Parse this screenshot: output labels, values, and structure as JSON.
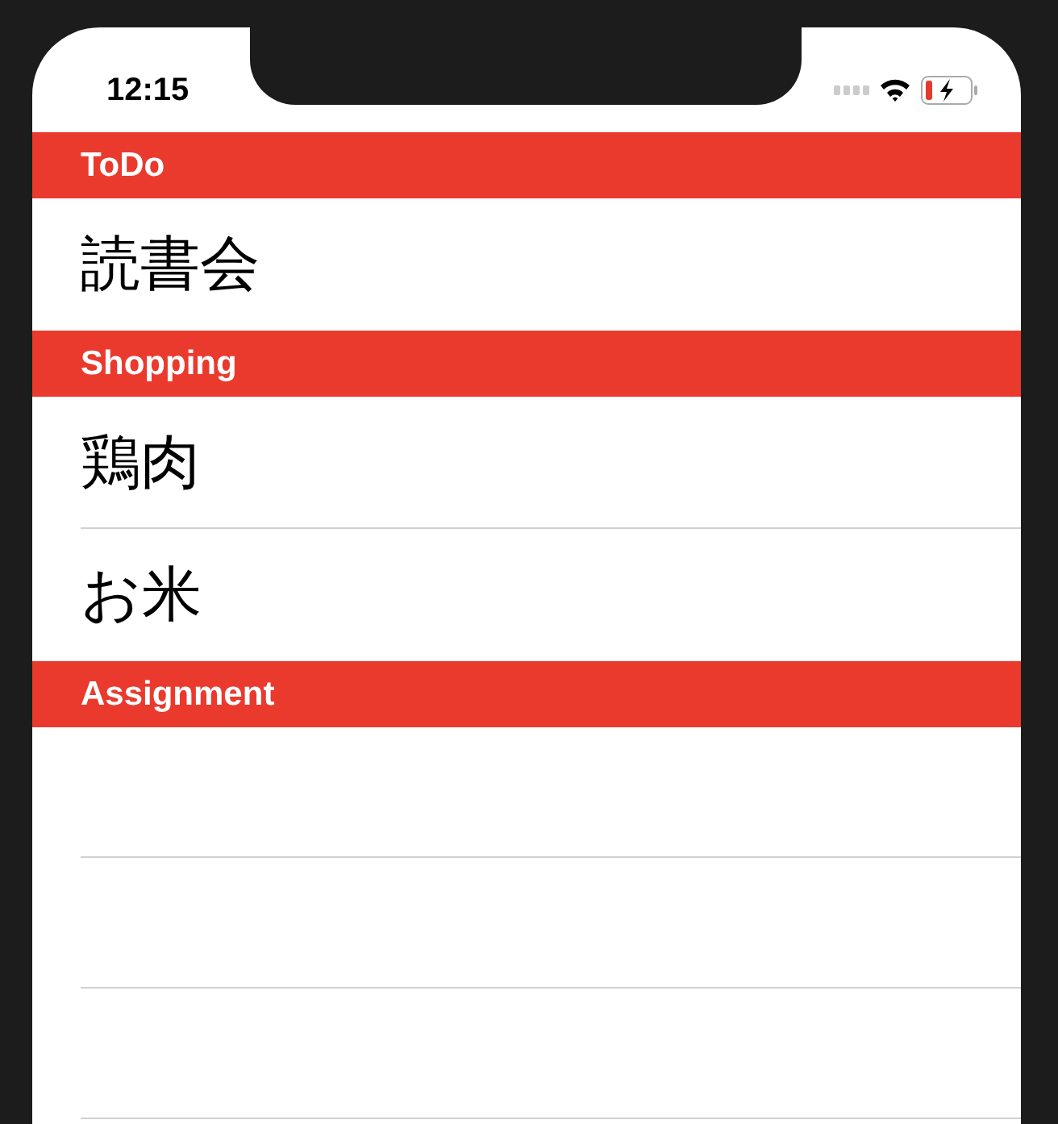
{
  "status_bar": {
    "time": "12:15"
  },
  "sections": [
    {
      "title": "ToDo",
      "rows": [
        "読書会"
      ]
    },
    {
      "title": "Shopping",
      "rows": [
        "鶏肉",
        "お米"
      ]
    },
    {
      "title": "Assignment"
    }
  ]
}
